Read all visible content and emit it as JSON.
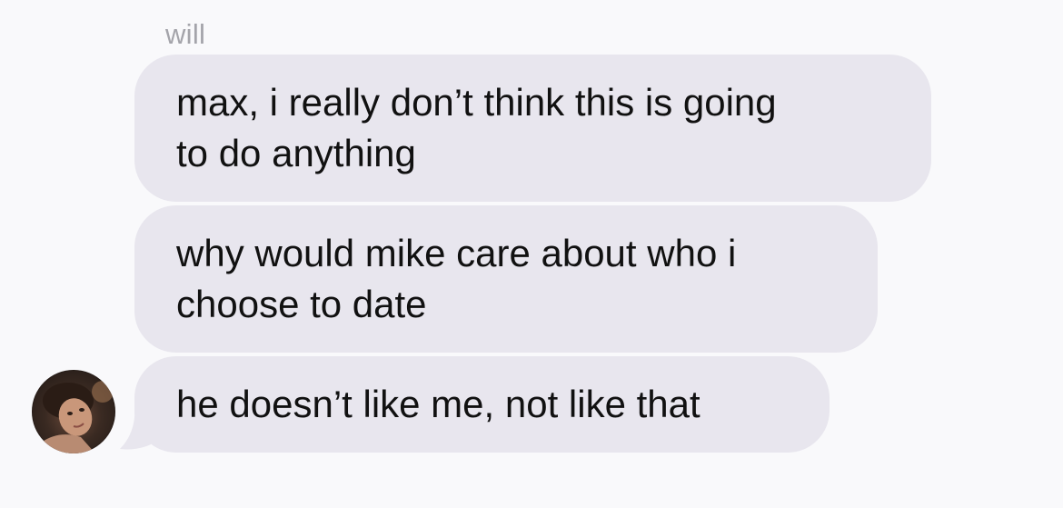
{
  "chat": {
    "sender_name": "will",
    "messages": [
      {
        "text": "max, i really don’t think this is going\nto do anything"
      },
      {
        "text": "why would mike care about who i\nchoose to date"
      },
      {
        "text": "he doesn’t like me, not like that"
      }
    ],
    "avatar_icon": "user-avatar-photo"
  },
  "colors": {
    "background": "#f9f9fb",
    "bubble": "#e8e6ee",
    "text": "#111111",
    "sender_label": "#a4a4aa"
  }
}
